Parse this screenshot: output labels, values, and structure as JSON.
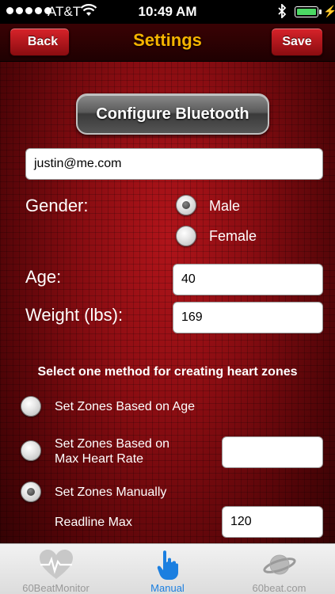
{
  "status_bar": {
    "carrier": "AT&T",
    "time": "10:49 AM",
    "wifi_icon": "wifi-icon",
    "bluetooth_icon": "bluetooth-icon",
    "battery_icon": "battery-icon",
    "battery_level": 1.0
  },
  "nav": {
    "title": "Settings",
    "back_label": "Back",
    "save_label": "Save"
  },
  "form": {
    "configure_bluetooth_label": "Configure Bluetooth",
    "email_value": "justin@me.com",
    "gender_label": "Gender:",
    "gender_options": [
      {
        "label": "Male",
        "selected": true
      },
      {
        "label": "Female",
        "selected": false
      }
    ],
    "age_label": "Age:",
    "age_value": "40",
    "weight_label": "Weight (lbs):",
    "weight_value": "169",
    "zones_heading": "Select one method for creating heart zones",
    "zone_options": [
      {
        "label": "Set Zones Based on Age",
        "selected": false
      },
      {
        "label_line1": "Set Zones Based on",
        "label_line2": "Max Heart Rate",
        "selected": false
      },
      {
        "label": "Set Zones Manually",
        "selected": true
      }
    ],
    "max_heart_rate_value": "",
    "readline_max_label": "Readline Max",
    "readline_max_value": "120"
  },
  "tabbar": {
    "tabs": [
      {
        "label": "60BeatMonitor",
        "icon": "heart-monitor-icon",
        "active": false
      },
      {
        "label": "Manual",
        "icon": "hand-pointer-icon",
        "active": true
      },
      {
        "label": "60beat.com",
        "icon": "planet-icon",
        "active": false
      }
    ]
  },
  "colors": {
    "title": "#f5b400",
    "accent_tab": "#1b7fe0",
    "background": "#8a0d12"
  }
}
